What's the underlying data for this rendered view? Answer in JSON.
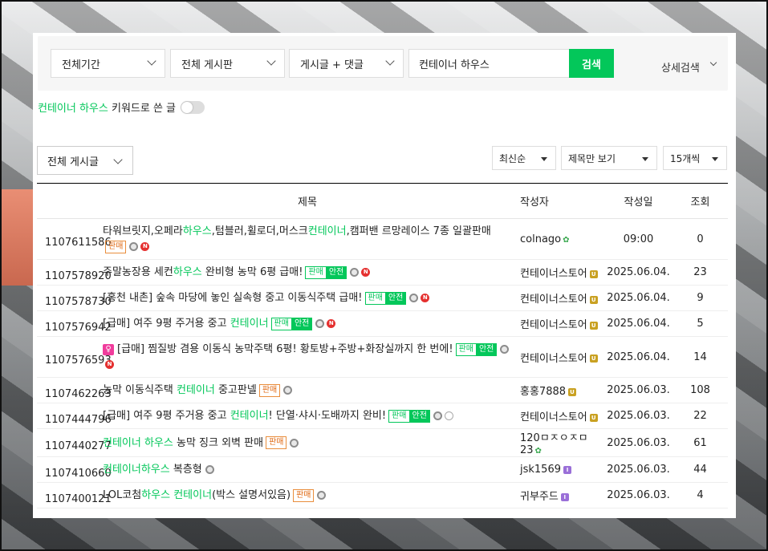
{
  "search": {
    "period": "전체기간",
    "board": "전체 게시판",
    "scope": "게시글 + 댓글",
    "query": "컨테이너 하우스",
    "search_button": "검색",
    "detail_search": "상세검색"
  },
  "keyword_filter": {
    "keyword": "컨테이너 하우스",
    "suffix": " 키워드로 쓴 글"
  },
  "list_controls": {
    "all_posts": "전체 게시글",
    "sort": "최신순",
    "view_mode": "제목만 보기",
    "per_page": "15개씩"
  },
  "table": {
    "headers": {
      "title": "제목",
      "writer": "작성자",
      "date": "작성일",
      "views": "조회"
    },
    "rows": [
      {
        "num": "1107611586",
        "title_parts": [
          "타워브릿지,오페라",
          "하우스",
          ",텀블러,휠로더,머스크",
          "컨테이너",
          ",캠퍼밴 르망레이스 7종 일괄판매"
        ],
        "tags": [
          "판매"
        ],
        "icons": [
          "image",
          "new"
        ],
        "writer": "colnago",
        "badge": "sprout",
        "date": "09:00",
        "views": "0"
      },
      {
        "num": "1107578920",
        "title_parts": [
          "주말농장용 세컨",
          "하우스",
          " 완비형 농막 6평 급매!"
        ],
        "tags": [
          "판매",
          "안전"
        ],
        "icons": [
          "image",
          "new"
        ],
        "writer": "컨테이너스토어",
        "badge": "gold",
        "date": "2025.06.04.",
        "views": "23"
      },
      {
        "num": "1107578730",
        "title_parts": [
          "[홍천 내촌] 숲속 마당에 놓인 실속형 중고 이동식주택 급매!"
        ],
        "tags": [
          "판매",
          "안전"
        ],
        "icons": [
          "image",
          "new"
        ],
        "writer": "컨테이너스토어",
        "badge": "gold",
        "date": "2025.06.04.",
        "views": "9"
      },
      {
        "num": "1107576942",
        "title_parts": [
          "[급매] 여주 9평 주거용 중고 ",
          "컨테이너"
        ],
        "tags": [
          "판매",
          "안전"
        ],
        "icons": [
          "image",
          "new"
        ],
        "writer": "컨테이너스토어",
        "badge": "gold",
        "date": "2025.06.04.",
        "views": "5"
      },
      {
        "num": "1107576593",
        "title_parts": [
          "[급매] 찜질방 겸용 이동식 농막주택 6평! 황토방+주방+화장실까지 한 번에!"
        ],
        "tags": [
          "판매",
          "안전"
        ],
        "icons": [
          "image",
          "new"
        ],
        "female": true,
        "writer": "컨테이너스토어",
        "badge": "gold",
        "date": "2025.06.04.",
        "views": "14"
      },
      {
        "num": "1107462263",
        "title_parts": [
          "농막 이동식주택 ",
          "컨테이너",
          " 중고판넬"
        ],
        "tags": [
          "판매"
        ],
        "icons": [
          "image"
        ],
        "writer": "홍홍7888",
        "badge": "gold",
        "date": "2025.06.03.",
        "views": "108"
      },
      {
        "num": "1107444796",
        "title_parts": [
          "[급매] 여주 9평 주거용 중고 ",
          "컨테이너",
          "! 단열·샤시·도배까지 완비!"
        ],
        "tags": [
          "판매",
          "안전"
        ],
        "icons": [
          "image",
          "link"
        ],
        "writer": "컨테이너스토어",
        "badge": "gold",
        "date": "2025.06.03.",
        "views": "22"
      },
      {
        "num": "1107440277",
        "title_parts": [
          "",
          "컨테이너 하우스",
          " 농막 징크 외벽 판매"
        ],
        "tags": [
          "판매"
        ],
        "icons": [
          "image"
        ],
        "writer": "120ㅁㅈㅇㅈㅁ23",
        "badge": "sprout",
        "date": "2025.06.03.",
        "views": "61"
      },
      {
        "num": "1107410660",
        "title_parts": [
          "",
          "컨테이너하우스",
          " 복층형"
        ],
        "tags": [],
        "icons": [
          "image"
        ],
        "writer": "jsk1569",
        "badge": "purple",
        "date": "2025.06.03.",
        "views": "44"
      },
      {
        "num": "1107400121",
        "title_parts": [
          "LOL코첨",
          "하우스",
          " ",
          "컨테이너",
          "(박스 설명서있음)"
        ],
        "tags": [
          "판매"
        ],
        "icons": [
          "image"
        ],
        "writer": "귀부주드",
        "badge": "purple",
        "date": "2025.06.03.",
        "views": "4"
      }
    ]
  },
  "colors": {
    "accent": "#03c75a",
    "sale_tag": "#e06b16",
    "new": "#e5302f"
  }
}
